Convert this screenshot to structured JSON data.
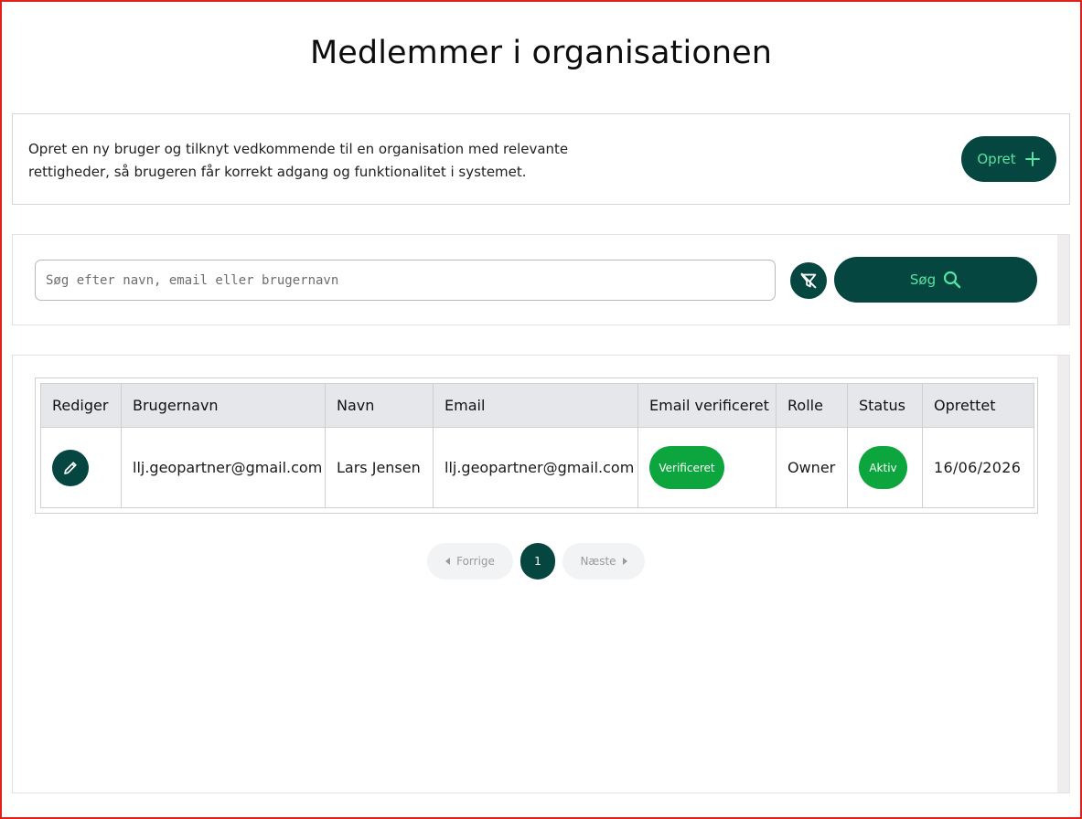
{
  "page": {
    "title": "Medlemmer i organisationen"
  },
  "intro": {
    "text_line1": "Opret en ny bruger og tilknyt vedkommende til en organisation med relevante",
    "text_line2": "rettigheder, så brugeren får korrekt adgang og funktionalitet i systemet.",
    "create_label": "Opret"
  },
  "search": {
    "placeholder": "Søg efter navn, email eller brugernavn",
    "value": "",
    "button_label": "Søg"
  },
  "table": {
    "headers": [
      "Rediger",
      "Brugernavn",
      "Navn",
      "Email",
      "Email verificeret",
      "Rolle",
      "Status",
      "Oprettet"
    ],
    "rows": [
      {
        "username": "llj.geopartner@gmail.com",
        "name": "Lars Jensen",
        "email": "llj.geopartner@gmail.com",
        "email_verified": "Verificeret",
        "role": "Owner",
        "status": "Aktiv",
        "created": "16/06/2026"
      }
    ]
  },
  "pagination": {
    "prev_label": "Forrige",
    "current_page": "1",
    "next_label": "Næste"
  },
  "colors": {
    "primary": "#064640",
    "accent": "#57e3a0",
    "success": "#0ca53e",
    "frame": "#e0201c"
  },
  "icons": {
    "create": "plus-icon",
    "clear_filter": "filter-off-icon",
    "search": "search-icon",
    "edit": "pencil-icon"
  }
}
